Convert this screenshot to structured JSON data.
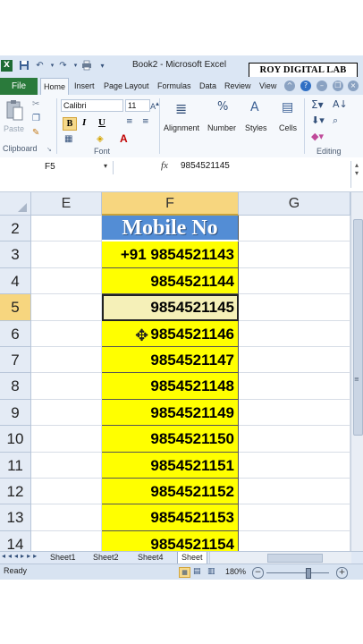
{
  "window": {
    "title": "Book2 - Microsoft Excel",
    "watermark": "ROY DIGITAL LAB"
  },
  "tabs": {
    "file": "File",
    "items": [
      "Home",
      "Insert",
      "Page Layout",
      "Formulas",
      "Data",
      "Review",
      "View"
    ],
    "active": "Home"
  },
  "ribbon": {
    "paste_label": "Paste",
    "clipboard_label": "Clipboard",
    "font_name": "Calibri",
    "font_size": "11",
    "bold": "B",
    "italic": "I",
    "underline": "U",
    "font_group_label": "Font",
    "alignment_label": "Alignment",
    "number_label": "Number",
    "styles_label": "Styles",
    "cells_label": "Cells",
    "editing_label": "Editing"
  },
  "formula_bar": {
    "name_box": "F5",
    "fx": "fx",
    "value": "9854521145"
  },
  "grid": {
    "columns": [
      "E",
      "F",
      "G"
    ],
    "rows": [
      {
        "num": "2",
        "f": "Mobile No"
      },
      {
        "num": "3",
        "f": "+91 9854521143"
      },
      {
        "num": "4",
        "f": "9854521144"
      },
      {
        "num": "5",
        "f": "9854521145"
      },
      {
        "num": "6",
        "f": "9854521146"
      },
      {
        "num": "7",
        "f": "9854521147"
      },
      {
        "num": "8",
        "f": "9854521148"
      },
      {
        "num": "9",
        "f": "9854521149"
      },
      {
        "num": "10",
        "f": "9854521150"
      },
      {
        "num": "11",
        "f": "9854521151"
      },
      {
        "num": "12",
        "f": "9854521152"
      },
      {
        "num": "13",
        "f": "9854521153"
      },
      {
        "num": "14",
        "f": "9854521154"
      }
    ],
    "header_fill": "#538dd5",
    "data_fill": "#ffff00",
    "selected_cell": "F5"
  },
  "sheets": [
    "Sheet1",
    "Sheet2",
    "Sheet4",
    "Sheet"
  ],
  "status": {
    "ready": "Ready",
    "zoom": "180%"
  }
}
